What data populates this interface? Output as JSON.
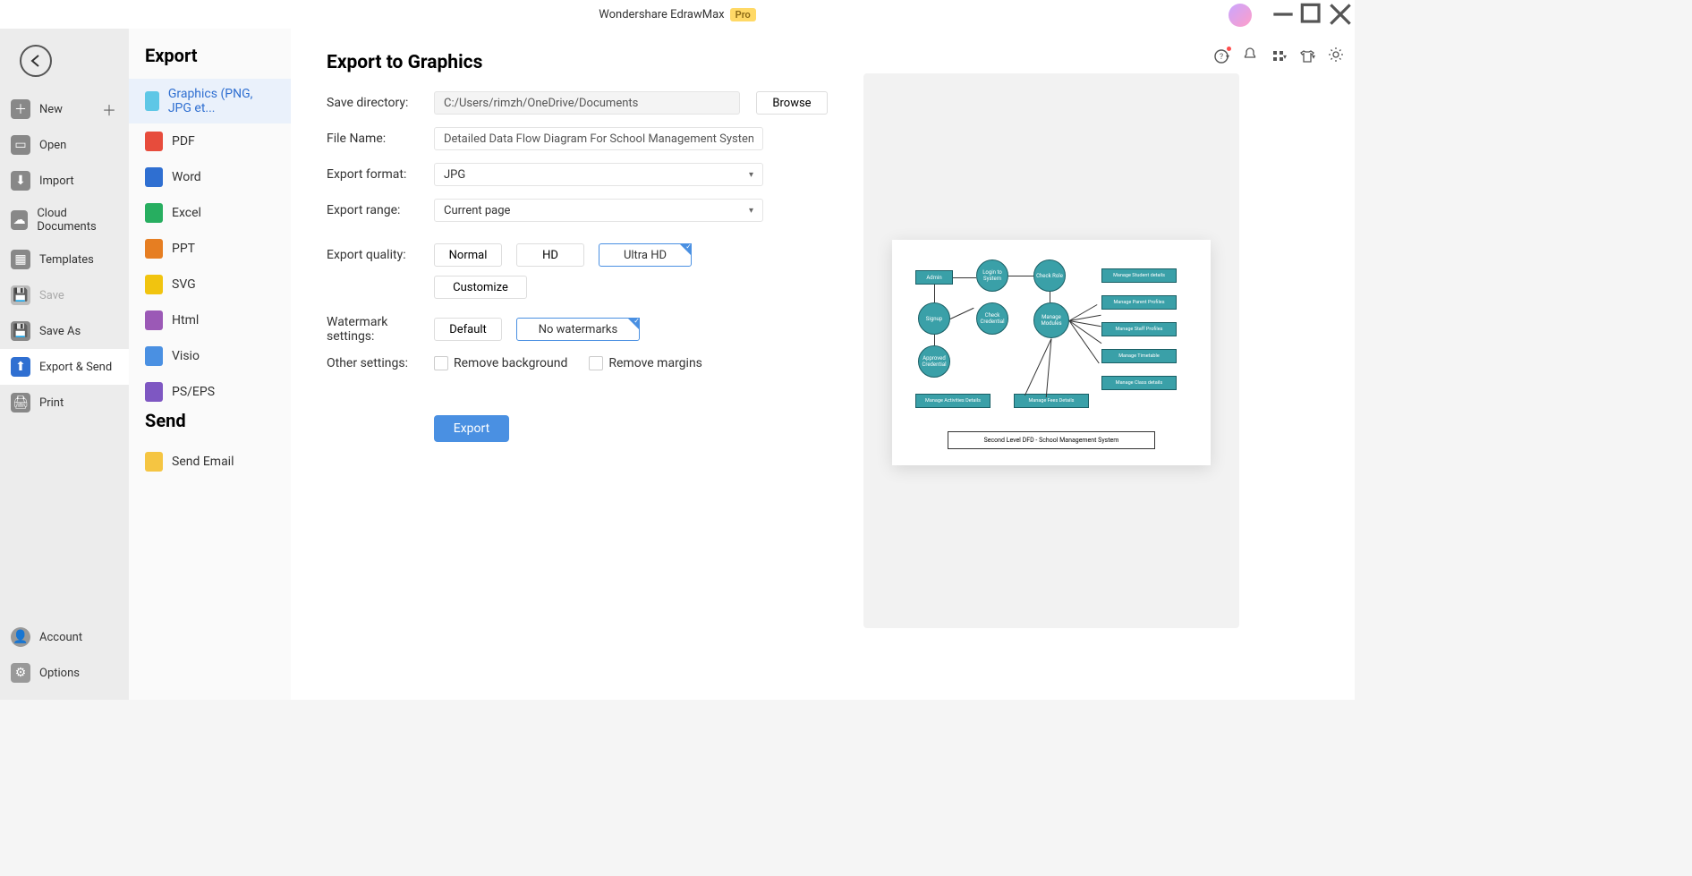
{
  "titlebar": {
    "app_name": "Wondershare EdrawMax",
    "badge": "Pro"
  },
  "nav1": {
    "items": [
      {
        "label": "New",
        "plus": true
      },
      {
        "label": "Open"
      },
      {
        "label": "Import"
      },
      {
        "label": "Cloud Documents"
      },
      {
        "label": "Templates"
      },
      {
        "label": "Save",
        "disabled": true
      },
      {
        "label": "Save As"
      },
      {
        "label": "Export & Send",
        "active": true
      },
      {
        "label": "Print"
      }
    ],
    "account_label": "Account",
    "options_label": "Options"
  },
  "sidebar2": {
    "header_export": "Export",
    "formats": [
      {
        "label": "Graphics (PNG, JPG et...",
        "color": "#5ec7e6",
        "active": true
      },
      {
        "label": "PDF",
        "color": "#e74c3c"
      },
      {
        "label": "Word",
        "color": "#2f6fd1"
      },
      {
        "label": "Excel",
        "color": "#27ae60"
      },
      {
        "label": "PPT",
        "color": "#e67e22"
      },
      {
        "label": "SVG",
        "color": "#f1c40f"
      },
      {
        "label": "Html",
        "color": "#9b59b6"
      },
      {
        "label": "Visio",
        "color": "#4a90e2"
      },
      {
        "label": "PS/EPS",
        "color": "#7e57c2"
      }
    ],
    "header_send": "Send",
    "send_email_label": "Send Email",
    "send_email_color": "#f5c542"
  },
  "main": {
    "title": "Export to Graphics",
    "labels": {
      "save_dir": "Save directory:",
      "file_name": "File Name:",
      "export_format": "Export format:",
      "export_range": "Export range:",
      "export_quality": "Export quality:",
      "watermark": "Watermark settings:",
      "other": "Other settings:"
    },
    "save_dir_value": "C:/Users/rimzh/OneDrive/Documents",
    "browse_label": "Browse",
    "file_name_value": "Detailed Data Flow Diagram For School Management System",
    "export_format_value": "JPG",
    "export_range_value": "Current page",
    "quality_options": {
      "normal": "Normal",
      "hd": "HD",
      "ultra": "Ultra HD",
      "customize": "Customize"
    },
    "watermark_options": {
      "default": "Default",
      "none": "No watermarks"
    },
    "other_options": {
      "remove_bg": "Remove background",
      "remove_margins": "Remove margins"
    },
    "export_button": "Export"
  },
  "preview": {
    "nodes": {
      "admin": "Admin",
      "signup": "Signup",
      "approved": "Approved Credential",
      "login": "Login to System",
      "check_cred": "Check Credential",
      "check_role": "Check Role",
      "manage_modules": "Manage Modules",
      "r1": "Manage Student details",
      "r2": "Manage Parent Profiles",
      "r3": "Manage Staff Profiles",
      "r4": "Manage Timetable",
      "r5": "Manage Class details",
      "b1": "Manage Activities Details",
      "b2": "Manage Fees Details",
      "footer": "Second Level DFD - School Management System"
    }
  }
}
